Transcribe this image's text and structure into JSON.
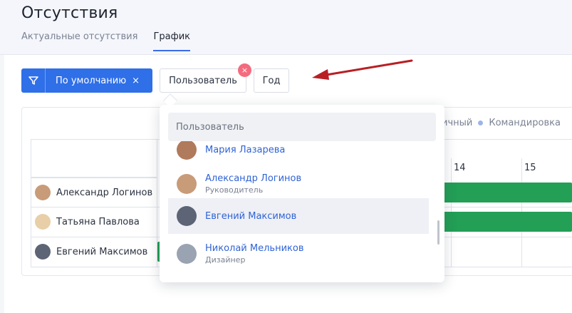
{
  "page": {
    "title": "Отсутствия",
    "tabs": [
      {
        "label": "Актуальные отсутствия",
        "active": false
      },
      {
        "label": "График",
        "active": true
      }
    ]
  },
  "filters": {
    "default_label": "По умолчанию",
    "default_clear": "×",
    "user_label": "Пользователь",
    "year_label": "Год",
    "clear_badge": "×"
  },
  "legend": {
    "partial": "ичный",
    "business_trip": "Командировка"
  },
  "calendar": {
    "days": [
      "14",
      "15"
    ],
    "users": [
      {
        "name": "Александр Логинов",
        "avatar_color": "#c89b79"
      },
      {
        "name": "Татьяна Павлова",
        "avatar_color": "#e8cfa8"
      },
      {
        "name": "Евгений Максимов",
        "avatar_color": "#5c6475"
      }
    ],
    "bar_color": "#239f56"
  },
  "dropdown": {
    "search_placeholder": "Пользователь",
    "items": [
      {
        "name": "Мария Лазарева",
        "role": "",
        "avatar_color": "#b07a5c"
      },
      {
        "name": "Александр Логинов",
        "role": "Руководитель",
        "avatar_color": "#c89b79"
      },
      {
        "name": "Евгений Максимов",
        "role": "",
        "avatar_color": "#5c6475",
        "selected": true
      },
      {
        "name": "Николай Мельников",
        "role": "Дизайнер",
        "avatar_color": "#9aa3b2"
      }
    ]
  },
  "colors": {
    "accent": "#2f6fe8",
    "link": "#2f63d6",
    "arrow": "#b81f24"
  }
}
